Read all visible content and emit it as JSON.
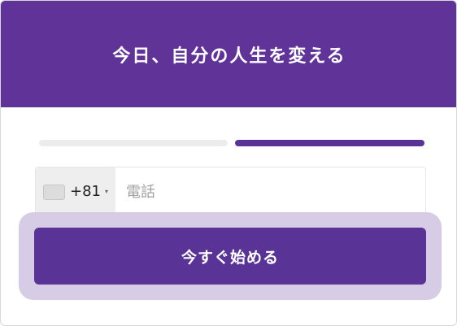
{
  "header": {
    "title": "今日、自分の人生を変える"
  },
  "progress": {
    "steps_total": 2,
    "current_step": 2
  },
  "phone": {
    "country_flag_icon": "country-flag-icon",
    "country_code": "+81",
    "caret": "▾",
    "placeholder": "電話",
    "value": ""
  },
  "cta": {
    "label": "今すぐ始める"
  },
  "colors": {
    "brand": "#603399",
    "button": "#5a3396",
    "focus_ring": "#d7cce6",
    "track": "#ececec"
  }
}
